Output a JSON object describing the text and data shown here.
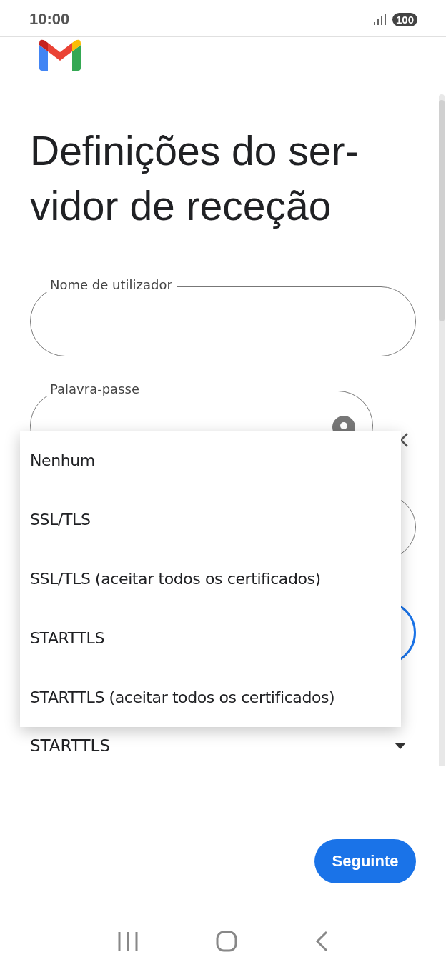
{
  "status_bar": {
    "time": "10:00",
    "battery": "100"
  },
  "title": "Definições do ser-\nvidor de receção",
  "fields": [
    {
      "label": "Nome de utilizador",
      "kind": "text"
    },
    {
      "label": "Palavra-passe",
      "kind": "password"
    }
  ],
  "security": {
    "value": "STARTTLS"
  },
  "menu": {
    "items": [
      {
        "label": "Nenhum",
        "selected": false
      },
      {
        "label": "SSL/TLS",
        "selected": false
      },
      {
        "label": "SSL/TLS (aceitar todos os certificados)",
        "selected": false
      },
      {
        "label": "STARTTLS",
        "selected": false
      },
      {
        "label": "STARTTLS (aceitar todos os certificados)",
        "selected": false
      }
    ]
  },
  "next_button": "Seguinte"
}
